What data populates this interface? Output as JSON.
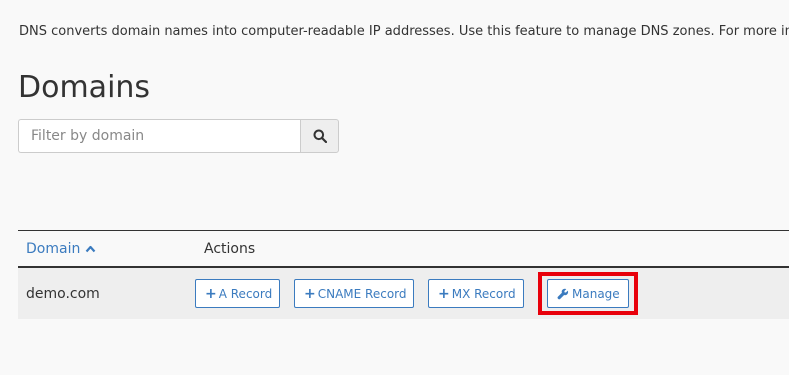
{
  "description": "DNS converts domain names into computer-readable IP addresses. Use this feature to manage DNS zones. For more in",
  "page_title": "Domains",
  "search": {
    "placeholder": "Filter by domain",
    "value": "",
    "button_icon": "search-icon"
  },
  "table": {
    "columns": {
      "domain": "Domain",
      "domain_sort": "ascending",
      "actions": "Actions"
    },
    "rows": [
      {
        "domain": "demo.com",
        "actions": {
          "a_record": "A Record",
          "cname_record": "CNAME Record",
          "mx_record": "MX Record",
          "manage": "Manage"
        }
      }
    ]
  },
  "colors": {
    "link": "#3b7bbf",
    "highlight": "#e8000b",
    "row_background": "#eeeeee",
    "page_background": "#f9f9f9"
  }
}
